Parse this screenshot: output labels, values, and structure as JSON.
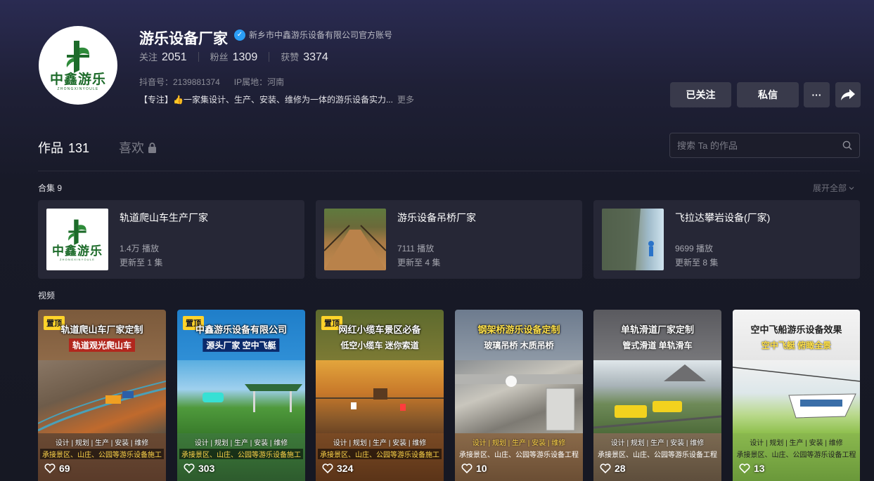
{
  "profile": {
    "name": "游乐设备厂家",
    "verified_text": "新乡市中鑫游乐设备有限公司官方账号",
    "logo_cn": "中鑫游乐",
    "logo_en": "ZHONGXINYOULE",
    "stats": {
      "following_label": "关注",
      "following": "2051",
      "followers_label": "粉丝",
      "followers": "1309",
      "likes_label": "获赞",
      "likes": "3374"
    },
    "douyin_id": "抖音号：2139881374",
    "ip_location": "IP属地：河南",
    "bio_tag": "【专注】",
    "bio_text": "一家集设计、生产、安装、维修为一体的游乐设备实力...",
    "bio_more": "更多"
  },
  "actions": {
    "followed": "已关注",
    "message": "私信",
    "more": "···",
    "share": "share-icon"
  },
  "tabs": {
    "works_label": "作品",
    "works_count": "131",
    "likes_label": "喜欢"
  },
  "search": {
    "placeholder": "搜索 Ta 的作品"
  },
  "collections": {
    "title": "合集 9",
    "expand": "展开全部",
    "items": [
      {
        "title": "轨道爬山车生产厂家",
        "plays": "1.4万 播放",
        "updated": "更新至 1 集"
      },
      {
        "title": "游乐设备吊桥厂家",
        "plays": "7111 播放",
        "updated": "更新至 4 集"
      },
      {
        "title": "飞拉达攀岩设备(厂家)",
        "plays": "9699 播放",
        "updated": "更新至 8 集"
      }
    ]
  },
  "videos": {
    "title": "视频",
    "pin_label": "置顶",
    "items": [
      {
        "title": "轨道爬山车厂家定制",
        "sub": "轨道观光爬山车",
        "line1": "设计 | 规划 | 生产 | 安装 | 维修",
        "line2": "承接景区、山庄、公园等游乐设备施工",
        "likes": "69",
        "pinned": true
      },
      {
        "title": "中鑫游乐设备有限公司",
        "sub": "源头厂家 空中飞艇",
        "line1": "设计 | 规划 | 生产 | 安装 | 维修",
        "line2": "承接景区、山庄、公园等游乐设备施工",
        "likes": "303",
        "pinned": true
      },
      {
        "title": "网红小缆车景区必备",
        "sub": "低空小缆车 迷你索道",
        "line1": "设计 | 规划 | 生产 | 安装 | 维修",
        "line2": "承接景区、山庄、公园等游乐设备施工",
        "likes": "324",
        "pinned": true
      },
      {
        "title": "钢架桥游乐设备定制",
        "sub": "玻璃吊桥 木质吊桥",
        "line1": "设计 | 规划 | 生产 | 安装 | 维修",
        "line2": "承接景区、山庄、公园等游乐设备工程",
        "likes": "10",
        "pinned": false
      },
      {
        "title": "单轨滑道厂家定制",
        "sub": "管式滑道 单轨滑车",
        "line1": "设计 | 规划 | 生产 | 安装 | 维修",
        "line2": "承接景区、山庄、公园等游乐设备工程",
        "likes": "28",
        "pinned": false
      },
      {
        "title": "空中飞船游乐设备效果",
        "sub": "空中飞艇 俯瞰全景",
        "line1": "设计 | 规划 | 生产 | 安装 | 维修",
        "line2": "承接景区、山庄、公园等游乐设备工程",
        "likes": "13",
        "pinned": false
      }
    ]
  },
  "colors": {
    "accent_green": "#1d6b2a",
    "pin_yellow": "#ffd32a",
    "verified_blue": "#2b9df5"
  }
}
